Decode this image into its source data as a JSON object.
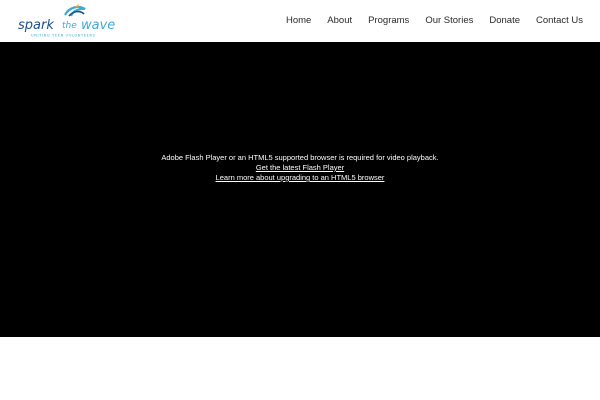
{
  "brand": {
    "logo_words": [
      "spark",
      "the",
      "wave"
    ],
    "tagline": "UNITING TEEN VOLUNTEERS",
    "colors": {
      "dark_blue": "#1d4f8a",
      "light_blue": "#3fa9d8",
      "orange": "#f0a020"
    }
  },
  "nav": {
    "items": [
      "Home",
      "About",
      "Programs",
      "Our Stories",
      "Donate",
      "Contact Us"
    ]
  },
  "video": {
    "message": "Adobe Flash Player or an HTML5 supported browser is required for video playback.",
    "link_flash": "Get the latest Flash Player ",
    "link_html5": "Learn more about upgrading to an HTML5 browser",
    "background": "#000000"
  }
}
